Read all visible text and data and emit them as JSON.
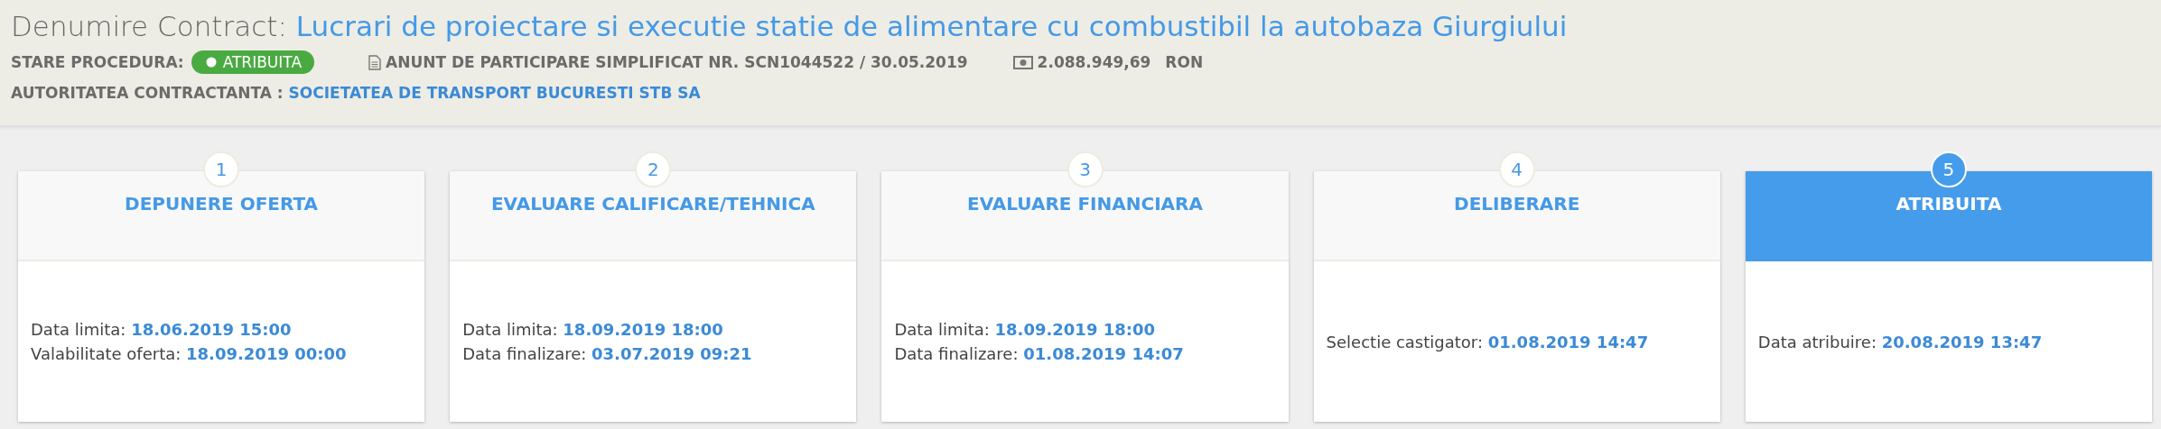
{
  "contract": {
    "label": "Denumire Contract:",
    "title": "Lucrari de proiectare si executie statie de alimentare cu combustibil la autobaza Giurgiului"
  },
  "procedure": {
    "label": "STARE PROCEDURA:",
    "status": "ATRIBUITA",
    "notice": "ANUNT DE PARTICIPARE SIMPLIFICAT NR. SCN1044522 / 30.05.2019",
    "amount": "2.088.949,69",
    "currency": "RON"
  },
  "authority": {
    "label": "AUTORITATEA CONTRACTANTA :",
    "name": "SOCIETATEA DE TRANSPORT BUCURESTI STB SA"
  },
  "steps": [
    {
      "number": "1",
      "title": "DEPUNERE OFERTA",
      "selected": false,
      "lines": [
        {
          "label": "Data limita:",
          "value": "18.06.2019 15:00"
        },
        {
          "label": "Valabilitate oferta:",
          "value": "18.09.2019 00:00"
        }
      ]
    },
    {
      "number": "2",
      "title": "EVALUARE CALIFICARE/TEHNICA",
      "selected": false,
      "lines": [
        {
          "label": "Data limita:",
          "value": "18.09.2019 18:00"
        },
        {
          "label": "Data finalizare:",
          "value": "03.07.2019 09:21"
        }
      ]
    },
    {
      "number": "3",
      "title": "EVALUARE FINANCIARA",
      "selected": false,
      "lines": [
        {
          "label": "Data limita:",
          "value": "18.09.2019 18:00"
        },
        {
          "label": "Data finalizare:",
          "value": "01.08.2019 14:07"
        }
      ]
    },
    {
      "number": "4",
      "title": "DELIBERARE",
      "selected": false,
      "lines": [
        {
          "label": "Selectie castigator:",
          "value": "01.08.2019 14:47"
        }
      ]
    },
    {
      "number": "5",
      "title": "ATRIBUITA",
      "selected": true,
      "lines": [
        {
          "label": "Data atribuire:",
          "value": "20.08.2019 13:47"
        }
      ]
    }
  ]
}
